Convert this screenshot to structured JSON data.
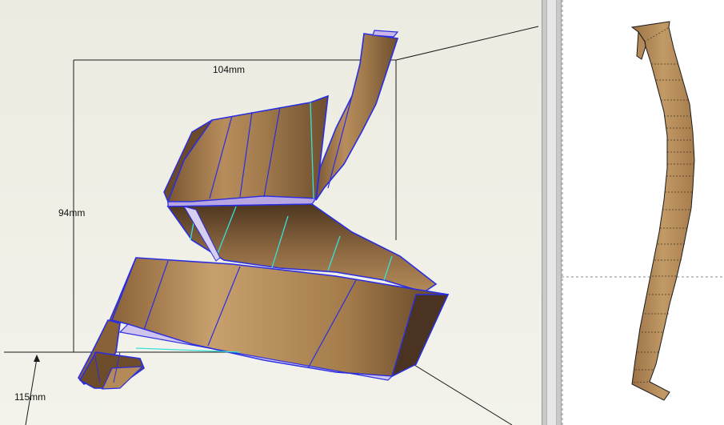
{
  "model_view": {
    "dimensions": {
      "width": "104mm",
      "height": "94mm",
      "depth": "115mm"
    }
  },
  "unfold_view": {
    "part": "unfolded-strip"
  },
  "colors": {
    "viewport_bg": "#efefe6",
    "edge_blue": "#2a2ee0",
    "fold_cyan": "#38e0d8",
    "cardboard": "#a07a4c",
    "splitter": "#c9c9c9"
  }
}
